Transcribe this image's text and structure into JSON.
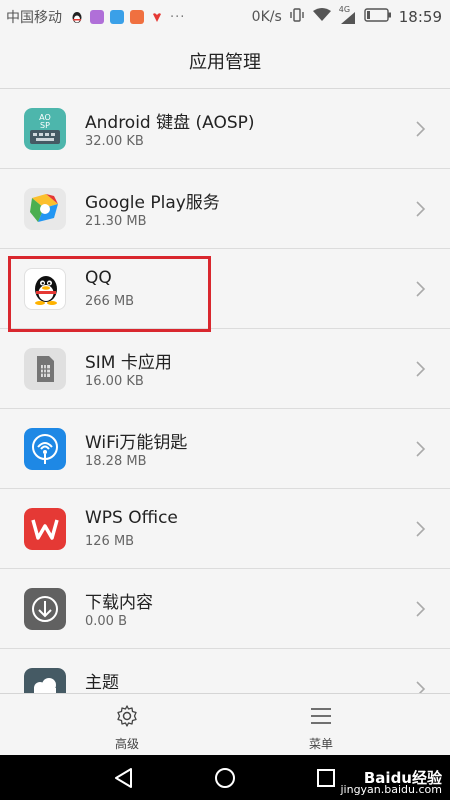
{
  "status_bar": {
    "carrier": "中国移动",
    "notification_icons": [
      "qq-icon",
      "gallery-icon",
      "sms-icon",
      "recorder-icon",
      "huawei-icon"
    ],
    "more": "···",
    "net_speed": "0K/s",
    "network_type": "4G",
    "time": "18:59"
  },
  "header": {
    "title": "应用管理"
  },
  "apps": [
    {
      "name": "Android 键盘 (AOSP)",
      "size": "32.00 KB",
      "icon": "android-keyboard-icon"
    },
    {
      "name": "Google Play服务",
      "size": "21.30 MB",
      "icon": "google-play-services-icon"
    },
    {
      "name": "QQ",
      "size": "266 MB",
      "icon": "qq-penguin-icon"
    },
    {
      "name": "SIM 卡应用",
      "size": "16.00 KB",
      "icon": "sim-card-icon"
    },
    {
      "name": "WiFi万能钥匙",
      "size": "18.28 MB",
      "icon": "wifi-key-icon"
    },
    {
      "name": "WPS Office",
      "size": "126 MB",
      "icon": "wps-office-icon"
    },
    {
      "name": "下载内容",
      "size": "0.00 B",
      "icon": "download-icon"
    },
    {
      "name": "主题",
      "size": "",
      "icon": "theme-icon"
    }
  ],
  "bottom_bar": {
    "advanced_label": "高级",
    "menu_label": "菜单"
  },
  "watermark": {
    "brand": "Baidu经验",
    "url": "jingyan.baidu.com"
  },
  "colors": {
    "highlight": "#d9272e",
    "background": "#f5f5f5"
  }
}
